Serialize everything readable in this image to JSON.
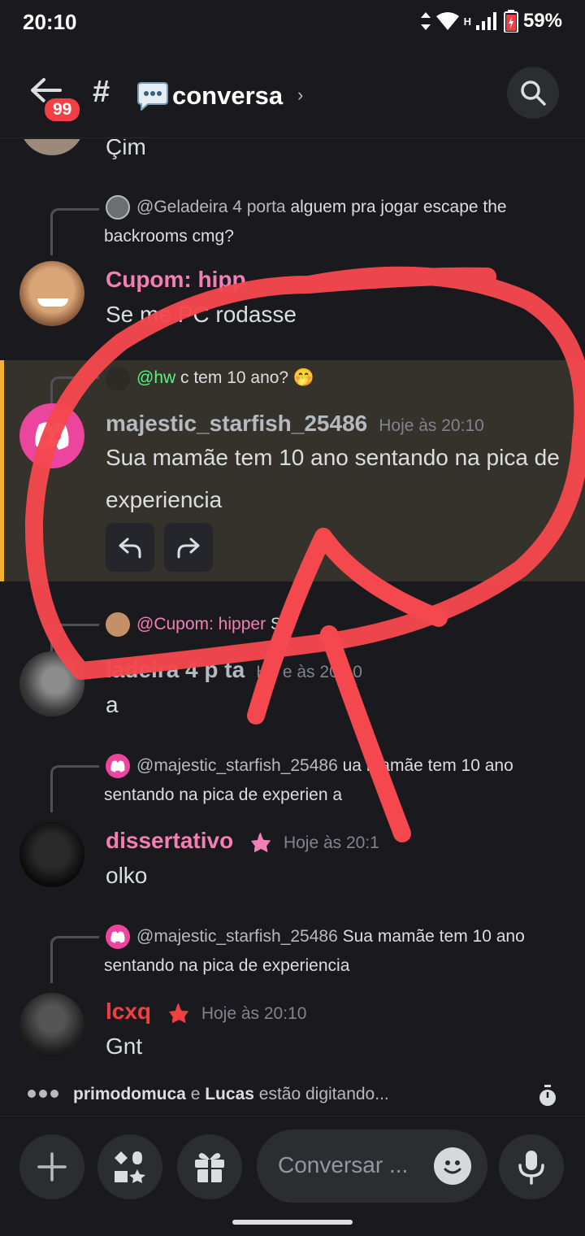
{
  "status_bar": {
    "time": "20:10",
    "network": "H",
    "battery": "59%"
  },
  "header": {
    "back_badge": "99",
    "hash": "#",
    "channel_name": "conversa",
    "chevron": "›"
  },
  "messages": [
    {
      "id": "m0",
      "content": "Çim"
    },
    {
      "id": "m1",
      "reply_author": "@Geladeira 4 porta",
      "reply_text": "alguem pra jogar escape the backrooms cmg?",
      "author": "Cupom: hipp",
      "content": "Se me    PC rodasse"
    },
    {
      "id": "m2",
      "reply_author": "@hw",
      "reply_text": "c tem 10 ano? 🤭",
      "author": "majestic_starfish_25486",
      "timestamp": "Hoje às 20:10",
      "content": "Sua mamãe tem 10 ano sentando na pica de experiencia"
    },
    {
      "id": "m3",
      "reply_author": "@Cupom: hipper",
      "reply_text": "S",
      "author": "    ladeira 4 p    ta",
      "timestamp": "Ho  e às 20:10",
      "content": "a"
    },
    {
      "id": "m4",
      "reply_author": "@majestic_starfish_25486",
      "reply_text": "ua mamãe tem 10 ano sentando na pica de experien  a",
      "author": "dissertativo",
      "timestamp": "Hoje às 20:1",
      "content": "olko"
    },
    {
      "id": "m5",
      "reply_author": "@majestic_starfish_25486",
      "reply_text": "Sua mamãe tem 10 ano sentando na pica de experiencia",
      "author": "lcxq",
      "timestamp": "Hoje às 20:10",
      "content": "Gnt"
    }
  ],
  "typing": {
    "user1": "primodomuca",
    "conj": "e",
    "user2": "Lucas",
    "suffix": "estão digitando..."
  },
  "input": {
    "placeholder": "Conversar ..."
  },
  "colors": {
    "background": "#1a1a1e",
    "highlight": "#35322b",
    "highlight_border": "#f0b232",
    "pink_author": "#f47fb4",
    "green_mention": "#57f287",
    "discord_pink": "#eb459e",
    "scribble": "#f5484e"
  },
  "icons": [
    "back-arrow-icon",
    "hash-icon",
    "speech-bubble-icon",
    "search-icon",
    "reply-icon",
    "forward-icon",
    "star-icon",
    "discord-logo-icon",
    "timer-icon",
    "plus-icon",
    "apps-icon",
    "gift-icon",
    "emoji-icon",
    "microphone-icon"
  ]
}
